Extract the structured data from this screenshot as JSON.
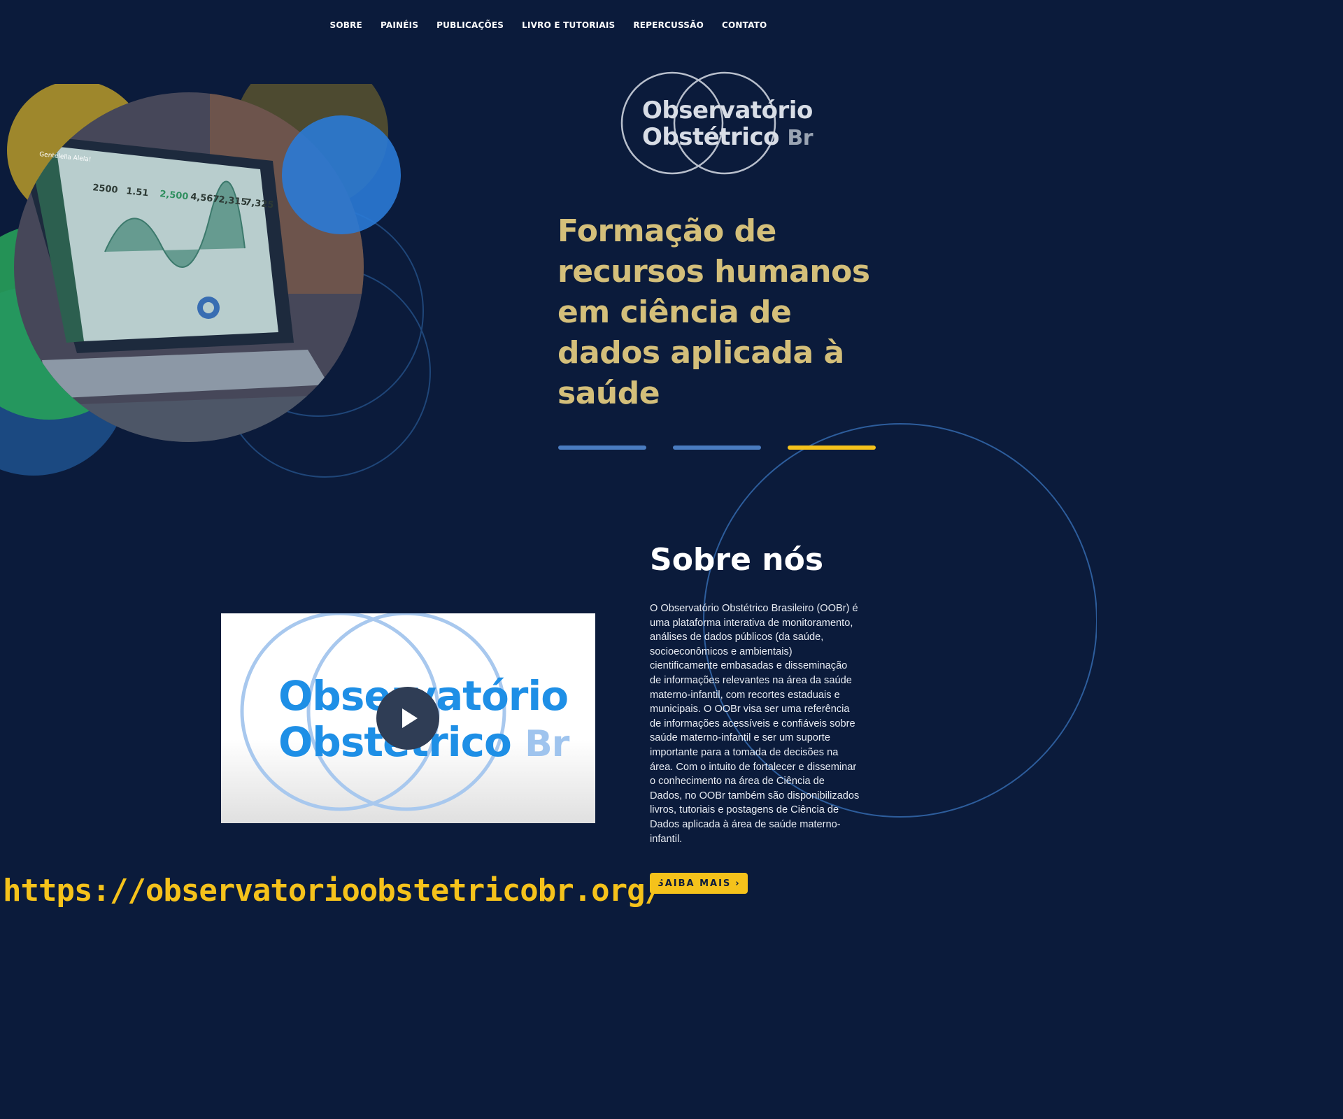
{
  "nav": {
    "items": [
      {
        "label": "SOBRE"
      },
      {
        "label": "PAINÉIS"
      },
      {
        "label": "PUBLICAÇÕES"
      },
      {
        "label": "LIVRO E TUTORIAIS"
      },
      {
        "label": "REPERCUSSÃO"
      },
      {
        "label": "CONTATO"
      }
    ]
  },
  "logo": {
    "line1": "Observatório",
    "line2": "Obstétrico",
    "suffix": "Br"
  },
  "hero": {
    "headline": "Formação de recursos humanos em ciência de dados aplicada à saúde",
    "bar_colors": [
      "#4a7cc0",
      "#4a7cc0",
      "#f5c21b"
    ]
  },
  "laptop_screen": {
    "app_title": "Gentelella Alela!",
    "stats": [
      "2500",
      "1.51",
      "2,500",
      "4,567",
      "2,315",
      "7,325"
    ]
  },
  "about": {
    "title": "Sobre nós",
    "text": "O Observatório Obstétrico Brasileiro (OOBr) é uma plataforma interativa de monitoramento, análises de dados públicos (da saúde, socioeconômicos e ambientais) cientificamente embasadas e disseminação de informações relevantes na área da saúde materno-infantil, com recortes estaduais e municipais. O OOBr visa ser uma referência de informações acessíveis e confiáveis sobre saúde materno-infantil e ser um suporte importante para a tomada de decisões na área. Com o intuito de fortalecer e disseminar o conhecimento na área de Ciência de Dados, no OOBr também são disponibilizados livros, tutoriais e postagens de Ciência de Dados aplicada à área de saúde materno-infantil.",
    "button_label": "SAIBA MAIS"
  },
  "video": {
    "line1": "Observatório",
    "line2": "Obstétrico",
    "suffix": "Br",
    "play_icon": "play-icon"
  },
  "overlay_url": "https://observatorioobstetricobr.org/",
  "colors": {
    "background": "#0b1b3b",
    "gold": "#d4bf7a",
    "accent_yellow": "#f5c21b",
    "line_blue": "#2d5d9c"
  }
}
